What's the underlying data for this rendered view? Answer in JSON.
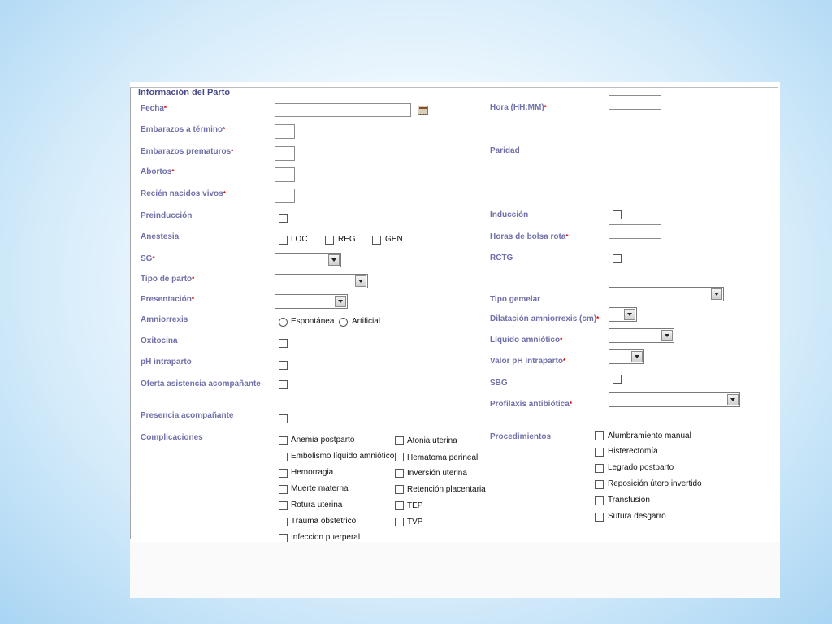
{
  "section_title": "Información del Parto",
  "required_mark": "*",
  "left_fields": {
    "fecha": "Fecha",
    "embarazos_termino": "Embarazos a término",
    "embarazos_prematuros": "Embarazos prematuros",
    "abortos": "Abortos",
    "recien_nacidos_vivos": "Recién nacidos vivos",
    "preinduccion": "Preinducción",
    "anestesia": "Anestesia",
    "sg": "SG",
    "tipo_parto": "Tipo de parto",
    "presentacion": "Presentación",
    "amniorrexis": "Amniorrexis",
    "oxitocina": "Oxitocina",
    "ph_intraparto": "pH intraparto",
    "oferta_asistencia": "Oferta asistencia acompañante",
    "presencia_acompanante": "Presencia acompañante",
    "complicaciones": "Complicaciones"
  },
  "right_fields": {
    "hora": "Hora (HH:MM)",
    "paridad": "Paridad",
    "induccion": "Inducción",
    "horas_bolsa_rota": "Horas de bolsa rota",
    "rctg": "RCTG",
    "tipo_gemelar": "Tipo gemelar",
    "dilatacion_amniorrexis": "Dilatación amniorrexis (cm)",
    "liquido_amniotico": "Líquido amniótico",
    "valor_ph_intraparto": "Valor pH intraparto",
    "sbg": "SBG",
    "profilaxis_antibiotica": "Profilaxis antibiótica",
    "procedimientos": "Procedimientos"
  },
  "anestesia_options": [
    "LOC",
    "REG",
    "GEN"
  ],
  "amniorrexis_options": [
    "Espontánea",
    "Artificial"
  ],
  "complicaciones_col1": [
    "Anemia postparto",
    "Embolismo líquido amniótico",
    "Hemorragia",
    "Muerte materna",
    "Rotura uterina",
    "Trauma obstetrico",
    "Infeccion puerperal"
  ],
  "complicaciones_col2": [
    "Atonia uterina",
    "Hematoma perineal",
    "Inversión uterina",
    "Retención placentaria",
    "TEP",
    "TVP"
  ],
  "procedimientos": [
    "Alumbramiento manual",
    "Histerectomía",
    "Legrado postparto",
    "Reposición útero invertido",
    "Transfusión",
    "Sutura desgarro"
  ],
  "colors": {
    "label": "#7070aa",
    "required": "#dd0000",
    "legend": "#4a4a8a"
  }
}
